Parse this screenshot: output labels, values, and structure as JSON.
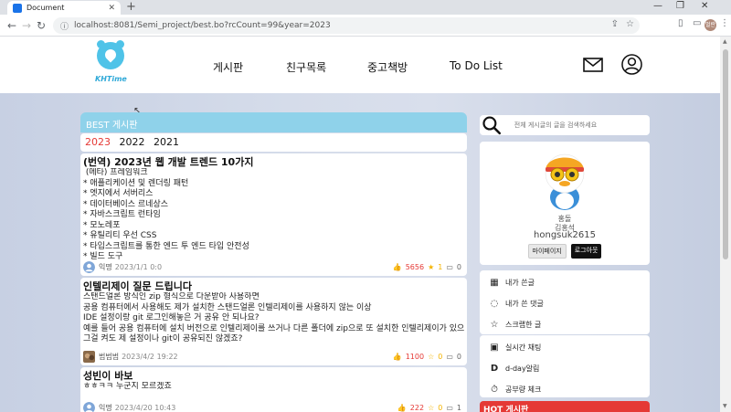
{
  "browser": {
    "tab_title": "Document",
    "url": "localhost:8081/Semi_project/best.bo?rcCount=99&year=2023",
    "profile_initials": "멀란"
  },
  "header": {
    "logo_text": "KHTime",
    "nav": [
      "게시판",
      "친구목록",
      "중고책방",
      "To Do List"
    ]
  },
  "best": {
    "title": "BEST 게시판",
    "years": [
      "2023",
      "2022",
      "2021"
    ],
    "active_year": "2023",
    "posts": [
      {
        "title": "(번역) 2023년 웹 개발 트렌드 10가지",
        "body": " (메타) 프레임워크\n* 애플리케이션 및 렌더링 패턴\n* 엣지에서 서버리스\n* 데이터베이스 르네상스\n* 자바스크립트 런타임\n* 모노레포\n* 유틸리티 우선 CSS\n* 타입스크립트를 통한 엔드 투 엔드 타입 안전성\n* 빌드 도구",
        "author": "익명",
        "date": "2023/1/1 0:0",
        "likes": "5656",
        "stars": "1",
        "comments": "0"
      },
      {
        "title": "인텔리제이 질문 드립니다",
        "body": "스탠드얼론 방식인 zip 형식으로 다운받아 사용하면\n공용 컴퓨터에서 사용해도 제가 설치한 스탠드얼론 인텔리제이를 사용하지 않는 이상\nIDE 설정이랑 git 로그인해놓은 거 공유 안 되나요?\n예를 들어 공용 컴퓨터에 설치 버전으로 인텔리제이를 쓰거나 다른 폴더에 zip으로 또 설치한 인텔리제이가 있으면\n그걸 켜도 제 설정이나 git이 공유되진 않겠죠?",
        "author": "범범범",
        "date": "2023/4/2 19:22",
        "likes": "1100",
        "stars": "0",
        "comments": "0"
      },
      {
        "title": "성빈이 바보",
        "body": "ㅎㅎㅋㅋ 누군지 모르겠죠",
        "author": "익명",
        "date": "2023/4/20 10:43",
        "likes": "222",
        "stars": "0",
        "comments": "1"
      }
    ]
  },
  "search": {
    "placeholder": "전체 게시글의 글을 검색하세요"
  },
  "profile": {
    "nickname": "홍돌",
    "name": "김홍석",
    "user_id": "hongsuk2615",
    "mypage_label": "마이페이지",
    "logout_label": "로그아웃"
  },
  "menu1": [
    "내가 쓴글",
    "내가 쓴 댓글",
    "스크랩한 글"
  ],
  "menu2": [
    "실시간 채팅",
    "d-day알림",
    "공부량 체크"
  ],
  "hot": {
    "title": "HOT 게시판"
  }
}
